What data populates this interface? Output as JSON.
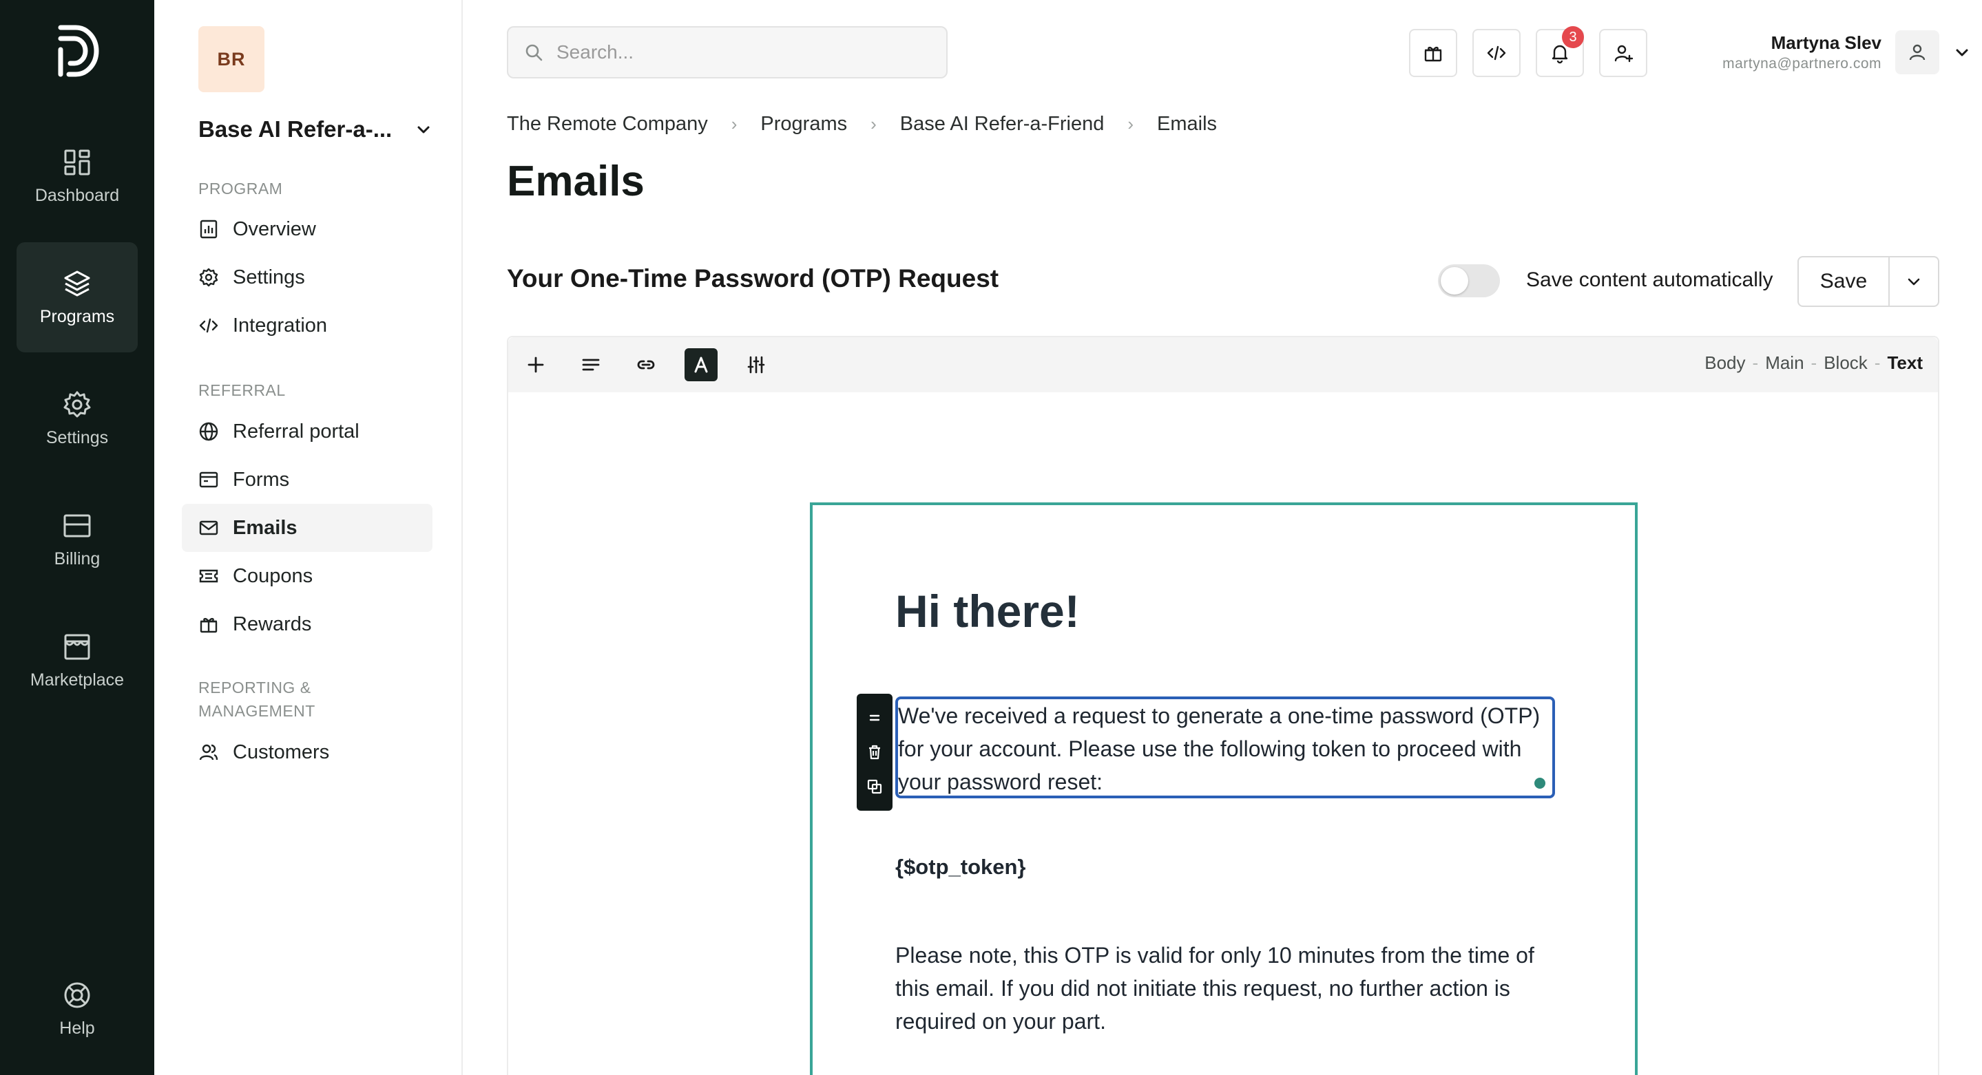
{
  "rail": {
    "items": [
      {
        "label": "Dashboard",
        "icon": "dashboard-icon"
      },
      {
        "label": "Programs",
        "icon": "layers-icon",
        "active": true
      },
      {
        "label": "Settings",
        "icon": "gear-icon"
      },
      {
        "label": "Billing",
        "icon": "billing-icon"
      },
      {
        "label": "Marketplace",
        "icon": "store-icon"
      }
    ],
    "help_label": "Help"
  },
  "sidebar": {
    "org_initials": "BR",
    "program_name": "Base AI Refer-a-...",
    "sections": {
      "program": "PROGRAM",
      "referral": "REFERRAL",
      "reporting": "REPORTING & MANAGEMENT"
    },
    "items": [
      {
        "label": "Overview",
        "icon": "report-icon"
      },
      {
        "label": "Settings",
        "icon": "gear-icon"
      },
      {
        "label": "Integration",
        "icon": "code-icon"
      },
      {
        "label": "Referral portal",
        "icon": "globe-icon"
      },
      {
        "label": "Forms",
        "icon": "form-icon"
      },
      {
        "label": "Emails",
        "icon": "mail-icon",
        "active": true
      },
      {
        "label": "Coupons",
        "icon": "coupon-icon"
      },
      {
        "label": "Rewards",
        "icon": "gift-icon"
      },
      {
        "label": "Customers",
        "icon": "users-icon"
      }
    ]
  },
  "header": {
    "search_placeholder": "Search...",
    "notification_count": "3",
    "user_name": "Martyna Slev",
    "user_email": "martyna@partnero.com"
  },
  "breadcrumb": [
    "The Remote Company",
    "Programs",
    "Base AI Refer-a-Friend",
    "Emails"
  ],
  "page_title": "Emails",
  "email": {
    "subject": "Your One-Time Password (OTP) Request",
    "autosave_label": "Save content automatically",
    "autosave_on": false,
    "save_label": "Save"
  },
  "editor": {
    "path": [
      "Body",
      "Main",
      "Block",
      "Text"
    ],
    "heading": "Hi there!",
    "paragraph1": "We've received a request to generate a one-time password (OTP) for your account. Please use the following token to proceed with your password reset:",
    "token": "{$otp_token}",
    "paragraph2": "Please note, this OTP is valid for only 10 minutes from the time of this email. If you did not initiate this request, no further action is required on your part."
  },
  "colors": {
    "rail_bg": "#0f1a17",
    "accent_teal": "#3aa597",
    "selection_blue": "#2b5fb6",
    "badge_red": "#e5484d"
  }
}
